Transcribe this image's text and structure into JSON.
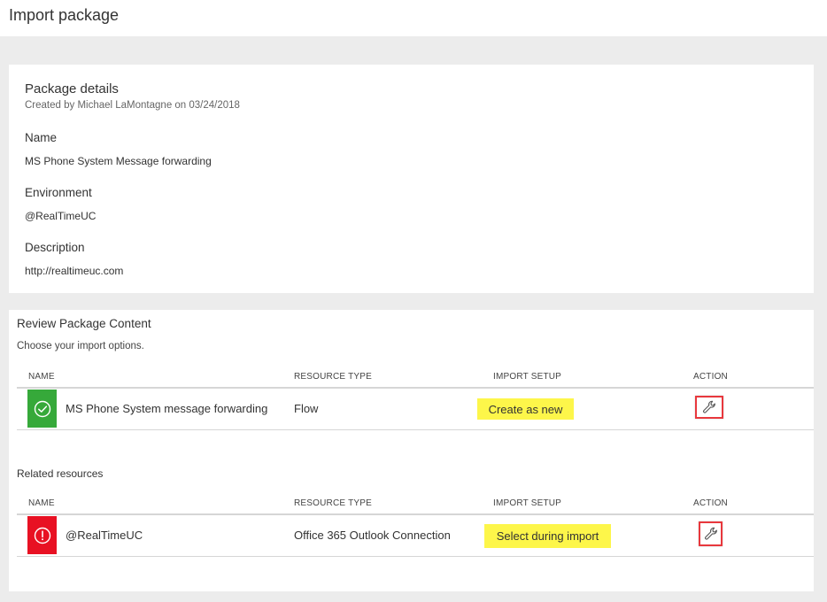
{
  "header": {
    "title": "Import package"
  },
  "details": {
    "title": "Package details",
    "created": "Created by Michael LaMontagne on 03/24/2018",
    "name_label": "Name",
    "name_value": "MS Phone System Message forwarding",
    "environment_label": "Environment",
    "environment_value": "@RealTimeUC",
    "description_label": "Description",
    "description_value": "http://realtimeuc.com"
  },
  "review": {
    "title": "Review Package Content",
    "subtitle": "Choose your import options.",
    "columns": [
      "NAME",
      "RESOURCE TYPE",
      "IMPORT SETUP",
      "ACTION"
    ],
    "rows": [
      {
        "status": "success",
        "name": "MS Phone System message forwarding",
        "resource_type": "Flow",
        "import_setup": "Create as new",
        "action_icon": "wrench-icon"
      }
    ]
  },
  "related": {
    "title": "Related resources",
    "columns": [
      "NAME",
      "RESOURCE TYPE",
      "IMPORT SETUP",
      "ACTION"
    ],
    "rows": [
      {
        "status": "error",
        "name": "@RealTimeUC",
        "resource_type": "Office 365 Outlook Connection",
        "import_setup": "Select during import",
        "action_icon": "wrench-icon"
      }
    ]
  },
  "colors": {
    "success": "#36a93a",
    "error": "#e81123",
    "highlight": "#fdf64a",
    "action_border": "#e8383d"
  }
}
